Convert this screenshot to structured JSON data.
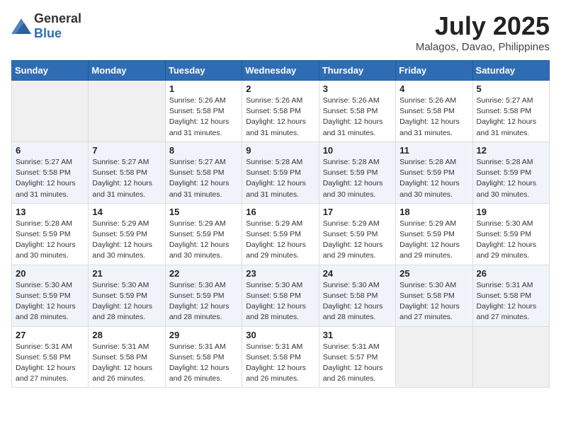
{
  "logo": {
    "general": "General",
    "blue": "Blue"
  },
  "title": {
    "month_year": "July 2025",
    "location": "Malagos, Davao, Philippines"
  },
  "weekdays": [
    "Sunday",
    "Monday",
    "Tuesday",
    "Wednesday",
    "Thursday",
    "Friday",
    "Saturday"
  ],
  "weeks": [
    [
      {
        "day": "",
        "sunrise": "",
        "sunset": "",
        "daylight": ""
      },
      {
        "day": "",
        "sunrise": "",
        "sunset": "",
        "daylight": ""
      },
      {
        "day": "1",
        "sunrise": "Sunrise: 5:26 AM",
        "sunset": "Sunset: 5:58 PM",
        "daylight": "Daylight: 12 hours and 31 minutes."
      },
      {
        "day": "2",
        "sunrise": "Sunrise: 5:26 AM",
        "sunset": "Sunset: 5:58 PM",
        "daylight": "Daylight: 12 hours and 31 minutes."
      },
      {
        "day": "3",
        "sunrise": "Sunrise: 5:26 AM",
        "sunset": "Sunset: 5:58 PM",
        "daylight": "Daylight: 12 hours and 31 minutes."
      },
      {
        "day": "4",
        "sunrise": "Sunrise: 5:26 AM",
        "sunset": "Sunset: 5:58 PM",
        "daylight": "Daylight: 12 hours and 31 minutes."
      },
      {
        "day": "5",
        "sunrise": "Sunrise: 5:27 AM",
        "sunset": "Sunset: 5:58 PM",
        "daylight": "Daylight: 12 hours and 31 minutes."
      }
    ],
    [
      {
        "day": "6",
        "sunrise": "Sunrise: 5:27 AM",
        "sunset": "Sunset: 5:58 PM",
        "daylight": "Daylight: 12 hours and 31 minutes."
      },
      {
        "day": "7",
        "sunrise": "Sunrise: 5:27 AM",
        "sunset": "Sunset: 5:58 PM",
        "daylight": "Daylight: 12 hours and 31 minutes."
      },
      {
        "day": "8",
        "sunrise": "Sunrise: 5:27 AM",
        "sunset": "Sunset: 5:58 PM",
        "daylight": "Daylight: 12 hours and 31 minutes."
      },
      {
        "day": "9",
        "sunrise": "Sunrise: 5:28 AM",
        "sunset": "Sunset: 5:59 PM",
        "daylight": "Daylight: 12 hours and 31 minutes."
      },
      {
        "day": "10",
        "sunrise": "Sunrise: 5:28 AM",
        "sunset": "Sunset: 5:59 PM",
        "daylight": "Daylight: 12 hours and 30 minutes."
      },
      {
        "day": "11",
        "sunrise": "Sunrise: 5:28 AM",
        "sunset": "Sunset: 5:59 PM",
        "daylight": "Daylight: 12 hours and 30 minutes."
      },
      {
        "day": "12",
        "sunrise": "Sunrise: 5:28 AM",
        "sunset": "Sunset: 5:59 PM",
        "daylight": "Daylight: 12 hours and 30 minutes."
      }
    ],
    [
      {
        "day": "13",
        "sunrise": "Sunrise: 5:28 AM",
        "sunset": "Sunset: 5:59 PM",
        "daylight": "Daylight: 12 hours and 30 minutes."
      },
      {
        "day": "14",
        "sunrise": "Sunrise: 5:29 AM",
        "sunset": "Sunset: 5:59 PM",
        "daylight": "Daylight: 12 hours and 30 minutes."
      },
      {
        "day": "15",
        "sunrise": "Sunrise: 5:29 AM",
        "sunset": "Sunset: 5:59 PM",
        "daylight": "Daylight: 12 hours and 30 minutes."
      },
      {
        "day": "16",
        "sunrise": "Sunrise: 5:29 AM",
        "sunset": "Sunset: 5:59 PM",
        "daylight": "Daylight: 12 hours and 29 minutes."
      },
      {
        "day": "17",
        "sunrise": "Sunrise: 5:29 AM",
        "sunset": "Sunset: 5:59 PM",
        "daylight": "Daylight: 12 hours and 29 minutes."
      },
      {
        "day": "18",
        "sunrise": "Sunrise: 5:29 AM",
        "sunset": "Sunset: 5:59 PM",
        "daylight": "Daylight: 12 hours and 29 minutes."
      },
      {
        "day": "19",
        "sunrise": "Sunrise: 5:30 AM",
        "sunset": "Sunset: 5:59 PM",
        "daylight": "Daylight: 12 hours and 29 minutes."
      }
    ],
    [
      {
        "day": "20",
        "sunrise": "Sunrise: 5:30 AM",
        "sunset": "Sunset: 5:59 PM",
        "daylight": "Daylight: 12 hours and 28 minutes."
      },
      {
        "day": "21",
        "sunrise": "Sunrise: 5:30 AM",
        "sunset": "Sunset: 5:59 PM",
        "daylight": "Daylight: 12 hours and 28 minutes."
      },
      {
        "day": "22",
        "sunrise": "Sunrise: 5:30 AM",
        "sunset": "Sunset: 5:59 PM",
        "daylight": "Daylight: 12 hours and 28 minutes."
      },
      {
        "day": "23",
        "sunrise": "Sunrise: 5:30 AM",
        "sunset": "Sunset: 5:58 PM",
        "daylight": "Daylight: 12 hours and 28 minutes."
      },
      {
        "day": "24",
        "sunrise": "Sunrise: 5:30 AM",
        "sunset": "Sunset: 5:58 PM",
        "daylight": "Daylight: 12 hours and 28 minutes."
      },
      {
        "day": "25",
        "sunrise": "Sunrise: 5:30 AM",
        "sunset": "Sunset: 5:58 PM",
        "daylight": "Daylight: 12 hours and 27 minutes."
      },
      {
        "day": "26",
        "sunrise": "Sunrise: 5:31 AM",
        "sunset": "Sunset: 5:58 PM",
        "daylight": "Daylight: 12 hours and 27 minutes."
      }
    ],
    [
      {
        "day": "27",
        "sunrise": "Sunrise: 5:31 AM",
        "sunset": "Sunset: 5:58 PM",
        "daylight": "Daylight: 12 hours and 27 minutes."
      },
      {
        "day": "28",
        "sunrise": "Sunrise: 5:31 AM",
        "sunset": "Sunset: 5:58 PM",
        "daylight": "Daylight: 12 hours and 26 minutes."
      },
      {
        "day": "29",
        "sunrise": "Sunrise: 5:31 AM",
        "sunset": "Sunset: 5:58 PM",
        "daylight": "Daylight: 12 hours and 26 minutes."
      },
      {
        "day": "30",
        "sunrise": "Sunrise: 5:31 AM",
        "sunset": "Sunset: 5:58 PM",
        "daylight": "Daylight: 12 hours and 26 minutes."
      },
      {
        "day": "31",
        "sunrise": "Sunrise: 5:31 AM",
        "sunset": "Sunset: 5:57 PM",
        "daylight": "Daylight: 12 hours and 26 minutes."
      },
      {
        "day": "",
        "sunrise": "",
        "sunset": "",
        "daylight": ""
      },
      {
        "day": "",
        "sunrise": "",
        "sunset": "",
        "daylight": ""
      }
    ]
  ]
}
